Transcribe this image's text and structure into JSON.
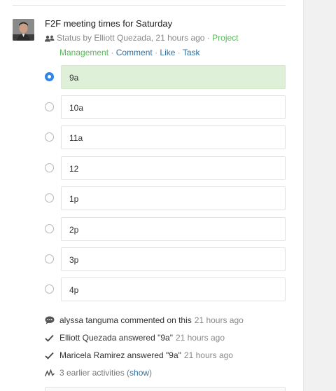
{
  "post": {
    "title": "F2F meeting times for Saturday",
    "meta_prefix": "Status by Elliott Quezada, 21 hours ago · ",
    "project_link": "Project Management",
    "project_part1": "Project",
    "project_part2": "Management",
    "actions": [
      "Comment",
      "Like",
      "Task"
    ]
  },
  "poll": {
    "selected_index": 0,
    "options": [
      "9a",
      "10a",
      "11a",
      "12",
      "1p",
      "2p",
      "3p",
      "4p"
    ]
  },
  "activity": [
    {
      "icon": "comment-icon",
      "text": "alyssa tanguma commented on this",
      "time": "21 hours ago"
    },
    {
      "icon": "checkmark-icon",
      "text": "Elliott Quezada answered \"9a\"",
      "time": "21 hours ago"
    },
    {
      "icon": "checkmark-icon",
      "text": "Maricela Ramirez answered \"9a\"",
      "time": "21 hours ago"
    }
  ],
  "earlier": {
    "text": "3 earlier activities (",
    "link": "show",
    "close": ")"
  },
  "colors": {
    "selected_bg": "#dff0d8",
    "radio_selected": "#2f86e8",
    "project_green": "#5cb85c",
    "link_blue": "#2f6f9f"
  }
}
